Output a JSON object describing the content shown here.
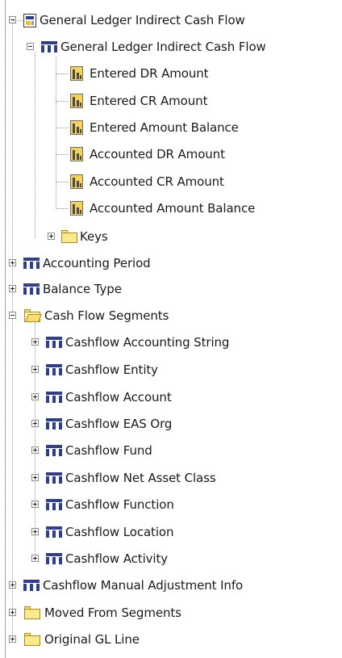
{
  "tree": {
    "root": {
      "label": "General Ledger Indirect Cash Flow",
      "icon": "presentation-folder-icon",
      "expanded": true
    },
    "main_table": {
      "label": "General Ledger Indirect Cash Flow",
      "icon": "presentation-table-icon",
      "expanded": true,
      "measures": [
        "Entered DR Amount",
        "Entered CR Amount",
        "Entered Amount Balance",
        "Accounted DR Amount",
        "Accounted CR Amount",
        "Accounted Amount Balance"
      ],
      "keys_folder": {
        "label": "Keys",
        "icon": "folder-icon",
        "expanded": false
      }
    },
    "accounting_period": {
      "label": "Accounting Period",
      "icon": "presentation-table-icon",
      "expanded": false
    },
    "balance_type": {
      "label": "Balance Type",
      "icon": "presentation-table-icon",
      "expanded": false
    },
    "cash_flow_segments": {
      "label": "Cash Flow Segments",
      "icon": "open-folder-icon",
      "expanded": true,
      "children": [
        "Cashflow Accounting String",
        "Cashflow Entity",
        "Cashflow Account",
        "Cashflow EAS Org",
        "Cashflow Fund",
        "Cashflow Net Asset Class",
        "Cashflow Function",
        "Cashflow Location",
        "Cashflow Activity"
      ]
    },
    "manual_adjustment": {
      "label": "Cashflow Manual Adjustment Info",
      "icon": "presentation-table-icon",
      "expanded": false
    },
    "moved_from_segments": {
      "label": "Moved From Segments",
      "icon": "folder-icon",
      "expanded": false
    },
    "original_gl_line": {
      "label": "Original GL Line",
      "icon": "folder-icon",
      "expanded": false
    }
  },
  "colors": {
    "table_icon": "#2d3f8e",
    "folder_icon": "#fbe98d",
    "tree_lines": "#9a9a9a"
  }
}
